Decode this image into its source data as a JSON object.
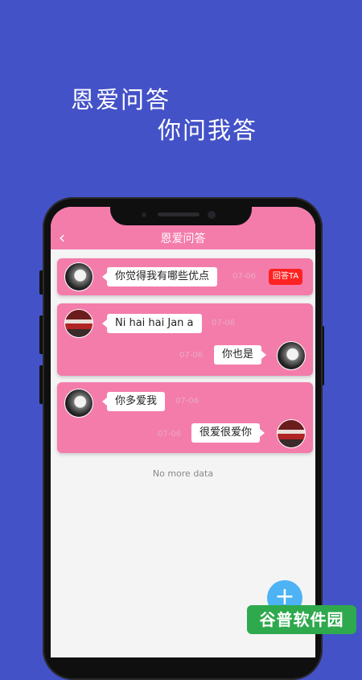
{
  "promo": {
    "line1": "恩爱问答",
    "line2": "你问我答"
  },
  "app": {
    "title": "恩爱问答",
    "back_icon": "‹"
  },
  "threads": [
    {
      "question": "你觉得我有哪些优点",
      "date": "07-06",
      "answer_button": "回答TA"
    },
    {
      "question": "Ni hai hai Jan a",
      "question_date": "07-06",
      "reply": "你也是",
      "reply_date": "07-06"
    },
    {
      "question": "你多爱我",
      "question_date": "07-06",
      "reply": "很爱很爱你",
      "reply_date": "07-06"
    }
  ],
  "list_footer": "No more data",
  "fab": {
    "icon": "+"
  },
  "watermark": "谷普软件园",
  "colors": {
    "background": "#4452c8",
    "accent": "#f47cab",
    "fab": "#4db3f4",
    "answer": "#ff2222"
  }
}
